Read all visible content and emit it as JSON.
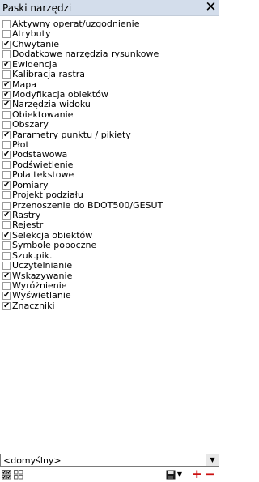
{
  "window": {
    "title": "Paski narzędzi",
    "close_glyph": "✕"
  },
  "toolbars": [
    {
      "label": "Aktywny operat/uzgodnienie",
      "checked": false
    },
    {
      "label": "Atrybuty",
      "checked": false
    },
    {
      "label": "Chwytanie",
      "checked": true
    },
    {
      "label": "Dodatkowe narzędzia rysunkowe",
      "checked": false
    },
    {
      "label": "Ewidencja",
      "checked": true
    },
    {
      "label": "Kalibracja rastra",
      "checked": false
    },
    {
      "label": "Mapa",
      "checked": true
    },
    {
      "label": "Modyfikacja obiektów",
      "checked": true
    },
    {
      "label": "Narzędzia widoku",
      "checked": true
    },
    {
      "label": "Obiektowanie",
      "checked": false
    },
    {
      "label": "Obszary",
      "checked": false
    },
    {
      "label": "Parametry punktu / pikiety",
      "checked": true
    },
    {
      "label": "Płot",
      "checked": false
    },
    {
      "label": "Podstawowa",
      "checked": true
    },
    {
      "label": "Podświetlenie",
      "checked": false
    },
    {
      "label": "Pola tekstowe",
      "checked": false
    },
    {
      "label": "Pomiary",
      "checked": true
    },
    {
      "label": "Projekt podziału",
      "checked": false
    },
    {
      "label": "Przenoszenie do BDOT500/GESUT",
      "checked": false
    },
    {
      "label": "Rastry",
      "checked": true
    },
    {
      "label": "Rejestr",
      "checked": false
    },
    {
      "label": "Selekcja obiektów",
      "checked": true
    },
    {
      "label": "Symbole poboczne",
      "checked": false
    },
    {
      "label": "Szuk.pik.",
      "checked": false
    },
    {
      "label": "Uczytelnianie",
      "checked": false
    },
    {
      "label": "Wskazywanie",
      "checked": true
    },
    {
      "label": "Wyróżnienie",
      "checked": false
    },
    {
      "label": "Wyświetlanie",
      "checked": true
    },
    {
      "label": "Znaczniki",
      "checked": true
    }
  ],
  "profile": {
    "selected": "<domyślny>"
  },
  "bottom_toolbar": {
    "icons": [
      "check-all-icon",
      "uncheck-all-icon",
      "save-icon",
      "dropdown-arrow-icon",
      "add-icon",
      "remove-icon"
    ],
    "add_glyph": "+",
    "remove_glyph": "−",
    "accent_red": "#cc1111"
  }
}
